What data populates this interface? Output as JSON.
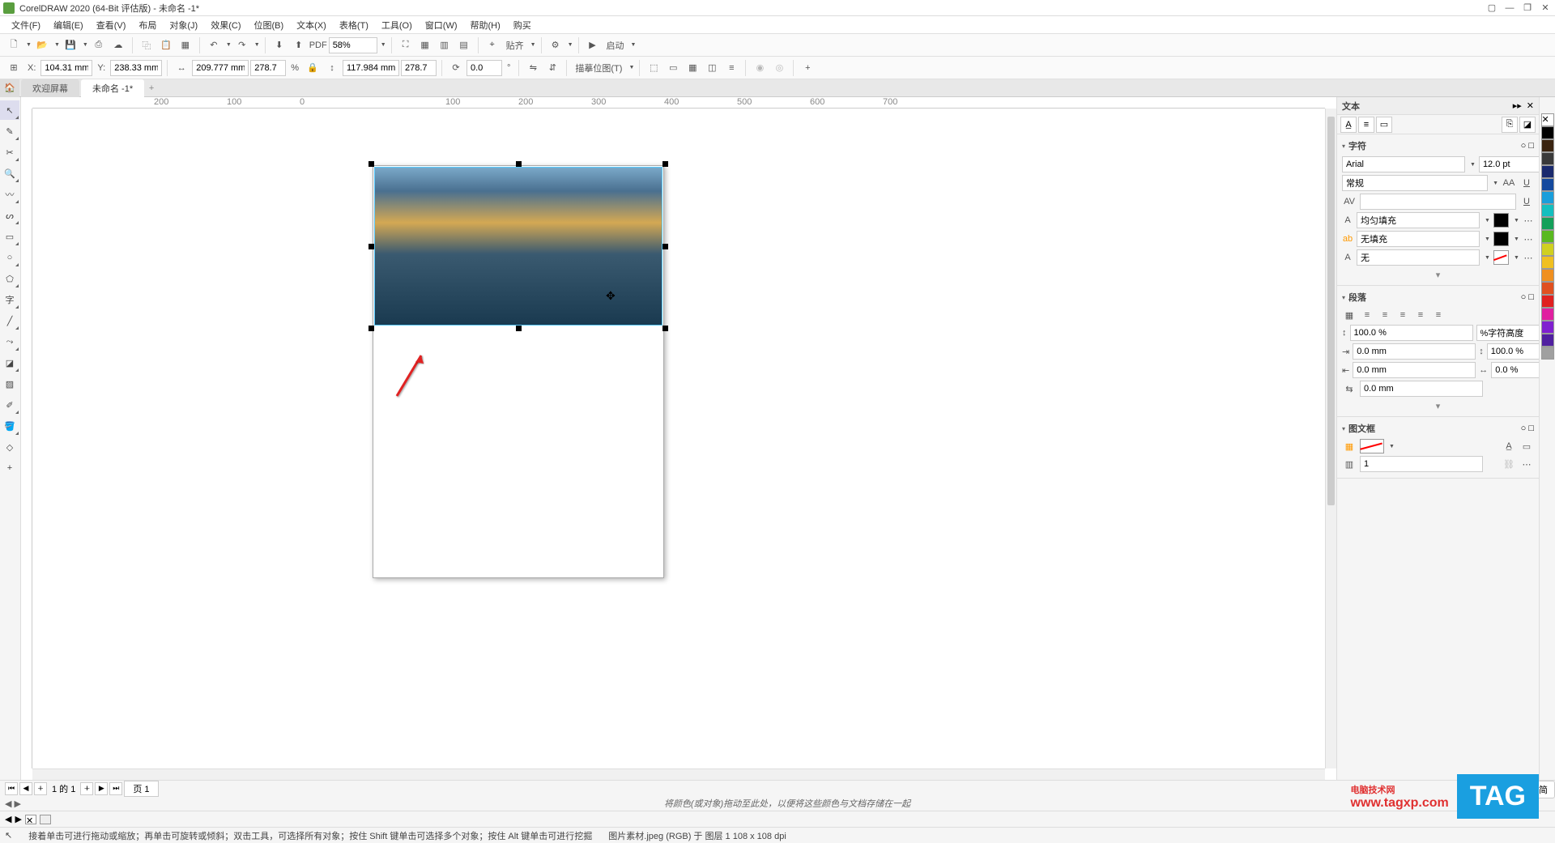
{
  "title": "CorelDRAW 2020 (64-Bit 评估版) - 未命名 -1*",
  "menu": [
    "文件(F)",
    "编辑(E)",
    "查看(V)",
    "布局",
    "对象(J)",
    "效果(C)",
    "位图(B)",
    "文本(X)",
    "表格(T)",
    "工具(O)",
    "窗口(W)",
    "帮助(H)",
    "购买"
  ],
  "toolbar1": {
    "zoom": "58%",
    "align": "贴齐",
    "launch": "启动"
  },
  "toolbar2": {
    "x": "104.31 mm",
    "y": "238.33 mm",
    "w": "209.777 mm",
    "h": "117.984 mm",
    "sx": "278.7",
    "sy": "278.7",
    "pct": "%",
    "rot": "0.0",
    "deg": "°",
    "trace": "描摹位图(T)"
  },
  "tabs": {
    "welcome": "欢迎屏幕",
    "active": "未命名 -1*"
  },
  "ruler_ticks": [
    "200",
    "100",
    "0",
    "",
    "100",
    "200",
    "300",
    "400",
    "500",
    "600",
    "700"
  ],
  "rightpanel": {
    "title": "文本",
    "sec_char": "字符",
    "font": "Arial",
    "font_size": "12.0 pt",
    "font_style": "常规",
    "fill_mode": "均匀填充",
    "no_fill": "无填充",
    "none": "无",
    "sec_para": "段落",
    "line_sp": "100.0 %",
    "char_h": "%字符高度",
    "before": "0.0 mm",
    "line_h": "100.0 %",
    "after": "0.0 mm",
    "char_sp": "0.0 %",
    "word_sp": "0.0 mm",
    "sec_frame": "图文框",
    "cols": "1"
  },
  "pagebar": {
    "page1": "页 1",
    "of": "1 的 1"
  },
  "langbar": "CH ♪ 简",
  "hint_center": "将颜色(或对象)拖动至此处，以便将这些颜色与文档存储在一起",
  "status": {
    "left": "接着单击可进行拖动或缩放；再单击可旋转或倾斜；双击工具，可选择所有对象；按住 Shift 键单击可选择多个对象；按住 Alt 键单击可进行挖掘",
    "right": "图片素材.jpeg (RGB) 于 图层 1 108 x 108 dpi"
  },
  "watermark": {
    "line1": "电脑技术网",
    "line2": "www.tagxp.com",
    "tag": "TAG"
  },
  "colors": [
    "#ffffff",
    "#000000",
    "#3a2410",
    "#3a3a3a",
    "#1a2a6e",
    "#14499e",
    "#1a9edb",
    "#14bfbf",
    "#14a05a",
    "#5ab920",
    "#d0d020",
    "#f0c020",
    "#f09020",
    "#e05020",
    "#e02020",
    "#e020a0",
    "#8020d0",
    "#5020a0",
    "#a0a0a0"
  ]
}
